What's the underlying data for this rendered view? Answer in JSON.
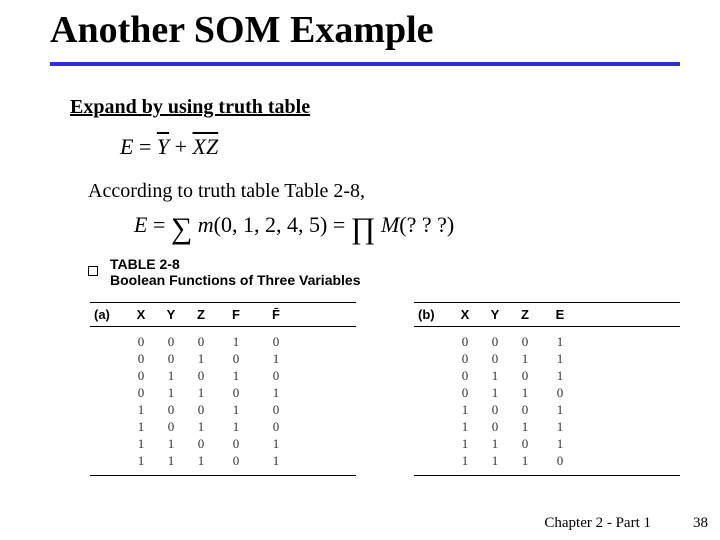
{
  "title": "Another SOM Example",
  "subhead": "Expand by using truth table",
  "eq1": {
    "lhs": "E",
    "eq": "=",
    "t1_over": "Y",
    "plus": "+",
    "t2_over": "XZ"
  },
  "line2": "According to truth table Table 2-8,",
  "eq2": {
    "lhs": "E",
    "eq": "=",
    "sum": "∑",
    "m": "m",
    "args": "(0, 1, 2, 4, 5)",
    "eq2": "=",
    "prod": "∏",
    "M": "M",
    "q": "(? ? ?)"
  },
  "tableCaption": {
    "l1": "TABLE 2-8",
    "l2": "Boolean Functions of Three Variables"
  },
  "tableA": {
    "label": "(a)",
    "headers": [
      "X",
      "Y",
      "Z",
      "F",
      "F̄"
    ],
    "rows": [
      [
        "0",
        "0",
        "0",
        "1",
        "0"
      ],
      [
        "0",
        "0",
        "1",
        "0",
        "1"
      ],
      [
        "0",
        "1",
        "0",
        "1",
        "0"
      ],
      [
        "0",
        "1",
        "1",
        "0",
        "1"
      ],
      [
        "1",
        "0",
        "0",
        "1",
        "0"
      ],
      [
        "1",
        "0",
        "1",
        "1",
        "0"
      ],
      [
        "1",
        "1",
        "0",
        "0",
        "1"
      ],
      [
        "1",
        "1",
        "1",
        "0",
        "1"
      ]
    ]
  },
  "tableB": {
    "label": "(b)",
    "headers": [
      "X",
      "Y",
      "Z",
      "E"
    ],
    "rows": [
      [
        "0",
        "0",
        "0",
        "1"
      ],
      [
        "0",
        "0",
        "1",
        "1"
      ],
      [
        "0",
        "1",
        "0",
        "1"
      ],
      [
        "0",
        "1",
        "1",
        "0"
      ],
      [
        "1",
        "0",
        "0",
        "1"
      ],
      [
        "1",
        "0",
        "1",
        "1"
      ],
      [
        "1",
        "1",
        "0",
        "1"
      ],
      [
        "1",
        "1",
        "1",
        "0"
      ]
    ]
  },
  "footer": {
    "chapter": "Chapter 2 - Part 1",
    "page": "38"
  }
}
